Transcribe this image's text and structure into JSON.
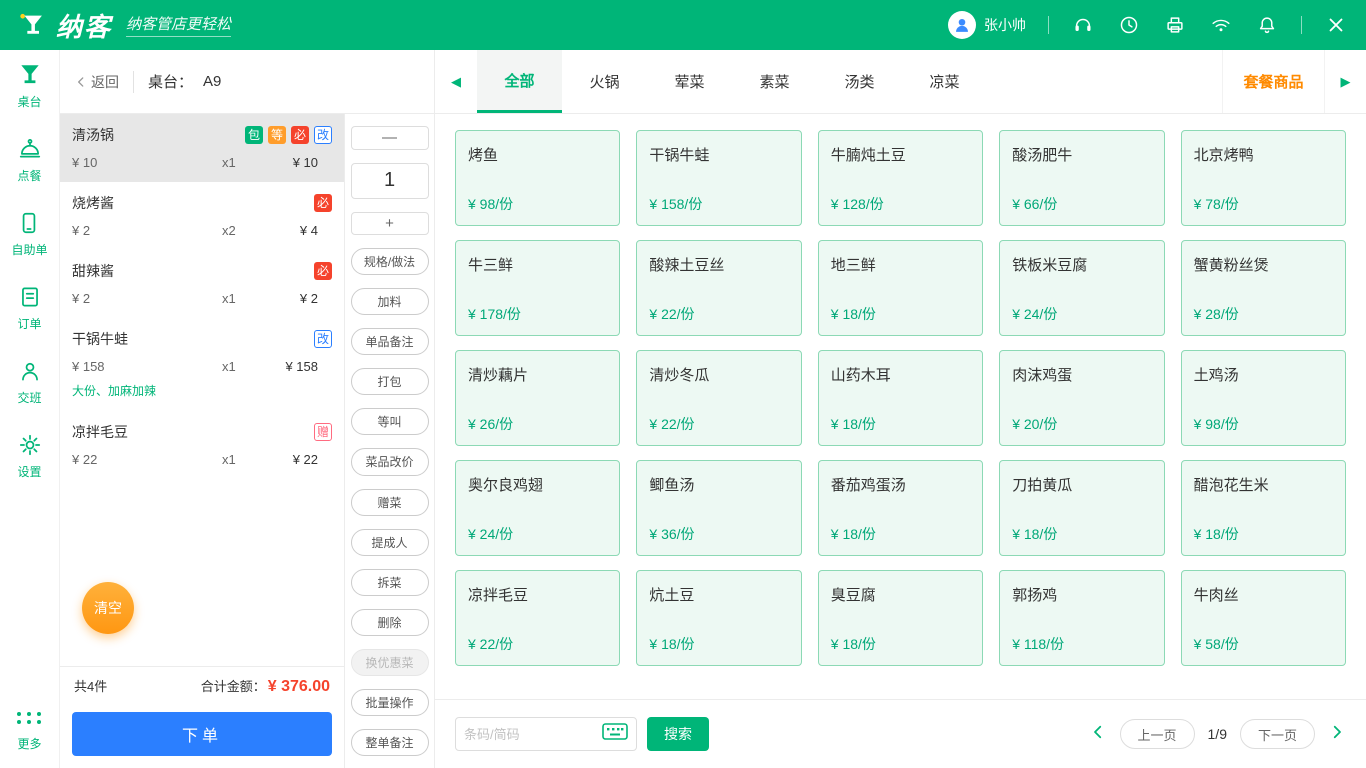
{
  "topbar": {
    "brand": "纳客",
    "tagline": "纳客管店更轻松",
    "user_name": "张小帅"
  },
  "sidebar": {
    "items": [
      {
        "label": "桌台"
      },
      {
        "label": "点餐"
      },
      {
        "label": "自助单"
      },
      {
        "label": "订单"
      },
      {
        "label": "交班"
      },
      {
        "label": "设置"
      },
      {
        "label": "更多"
      }
    ]
  },
  "order_panel": {
    "back_label": "返回",
    "table_label": "桌台：",
    "table_name": "A9",
    "items": [
      {
        "name": "清汤锅",
        "price": "¥ 10",
        "qty": "x1",
        "total": "¥ 10",
        "badges": [
          {
            "text": "包"
          },
          {
            "text": "等"
          },
          {
            "text": "必"
          },
          {
            "text": "改"
          }
        ]
      },
      {
        "name": "烧烤酱",
        "price": "¥ 2",
        "qty": "x2",
        "total": "¥ 4",
        "badges": [
          {
            "text": "必"
          }
        ]
      },
      {
        "name": "甜辣酱",
        "price": "¥ 2",
        "qty": "x1",
        "total": "¥ 2",
        "badges": [
          {
            "text": "必"
          }
        ]
      },
      {
        "name": "干锅牛蛙",
        "price": "¥ 158",
        "qty": "x1",
        "total": "¥ 158",
        "note": "大份、加麻加辣",
        "badges": [
          {
            "text": "改"
          }
        ]
      },
      {
        "name": "凉拌毛豆",
        "price": "¥ 22",
        "qty": "x1",
        "total": "¥ 22",
        "badges": [
          {
            "text": "赠"
          }
        ]
      }
    ],
    "clear_label": "清空",
    "count_label": "共4件",
    "total_label": "合计金额：",
    "total_amount": "¥ 376.00",
    "submit_label": "下单"
  },
  "actions": {
    "minus_label": "—",
    "qty_value": "1",
    "plus_label": "+",
    "buttons": [
      {
        "label": "规格/做法"
      },
      {
        "label": "加料"
      },
      {
        "label": "单品备注"
      },
      {
        "label": "打包"
      },
      {
        "label": "等叫"
      },
      {
        "label": "菜品改价"
      },
      {
        "label": "赠菜"
      },
      {
        "label": "提成人"
      },
      {
        "label": "拆菜"
      },
      {
        "label": "删除"
      },
      {
        "label": "换优惠菜"
      },
      {
        "label": "批量操作"
      },
      {
        "label": "整单备注"
      }
    ]
  },
  "categories": {
    "tabs": [
      {
        "label": "全部"
      },
      {
        "label": "火锅"
      },
      {
        "label": "荤菜"
      },
      {
        "label": "素菜"
      },
      {
        "label": "汤类"
      },
      {
        "label": "凉菜"
      }
    ],
    "combo_label": "套餐商品"
  },
  "menu": {
    "items": [
      {
        "name": "烤鱼",
        "price": "¥ 98/份"
      },
      {
        "name": "干锅牛蛙",
        "price": "¥ 158/份"
      },
      {
        "name": "牛腩炖土豆",
        "price": "¥ 128/份"
      },
      {
        "name": "酸汤肥牛",
        "price": "¥ 66/份"
      },
      {
        "name": "北京烤鸭",
        "price": "¥ 78/份"
      },
      {
        "name": "牛三鲜",
        "price": "¥ 178/份"
      },
      {
        "name": "酸辣土豆丝",
        "price": "¥ 22/份"
      },
      {
        "name": "地三鲜",
        "price": "¥ 18/份"
      },
      {
        "name": "铁板米豆腐",
        "price": "¥ 24/份"
      },
      {
        "name": "蟹黄粉丝煲",
        "price": "¥ 28/份"
      },
      {
        "name": "清炒藕片",
        "price": "¥ 26/份"
      },
      {
        "name": "清炒冬瓜",
        "price": "¥ 22/份"
      },
      {
        "name": "山药木耳",
        "price": "¥ 18/份"
      },
      {
        "name": "肉沫鸡蛋",
        "price": "¥ 20/份"
      },
      {
        "name": "土鸡汤",
        "price": "¥ 98/份"
      },
      {
        "name": "奥尔良鸡翅",
        "price": "¥ 24/份"
      },
      {
        "name": "鲫鱼汤",
        "price": "¥ 36/份"
      },
      {
        "name": "番茄鸡蛋汤",
        "price": "¥ 18/份"
      },
      {
        "name": "刀拍黄瓜",
        "price": "¥ 18/份"
      },
      {
        "name": "醋泡花生米",
        "price": "¥ 18/份"
      },
      {
        "name": "凉拌毛豆",
        "price": "¥ 22/份"
      },
      {
        "name": "炕土豆",
        "price": "¥ 18/份"
      },
      {
        "name": "臭豆腐",
        "price": "¥ 18/份"
      },
      {
        "name": "郭扬鸡",
        "price": "¥ 118/份"
      },
      {
        "name": "牛肉丝",
        "price": "¥ 58/份"
      }
    ]
  },
  "bottom_bar": {
    "search_placeholder": "条码/简码",
    "search_label": "搜索",
    "prev_label": "上一页",
    "page_indicator": "1/9",
    "next_label": "下一页"
  },
  "colors": {
    "brand_green": "#00b578",
    "combo_orange": "#ff8a00",
    "submit_blue": "#2b7fff",
    "total_red": "#f5432c",
    "clear_orange": "#ffa216"
  }
}
